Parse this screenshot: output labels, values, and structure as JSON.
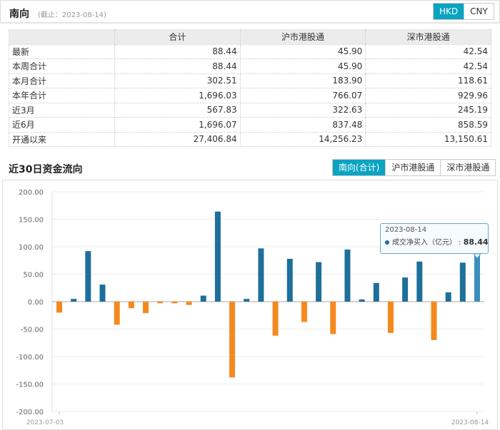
{
  "header": {
    "title": "南向",
    "subtitle": "(截止：2023-08-14)",
    "currency_options": [
      "HKD",
      "CNY"
    ],
    "currency_selected": "HKD"
  },
  "table": {
    "columns": [
      "",
      "合计",
      "沪市港股通",
      "深市港股通"
    ],
    "rows": [
      [
        "最新",
        "88.44",
        "45.90",
        "42.54"
      ],
      [
        "本周合计",
        "88.44",
        "45.90",
        "42.54"
      ],
      [
        "本月合计",
        "302.51",
        "183.90",
        "118.61"
      ],
      [
        "本年合计",
        "1,696.03",
        "766.07",
        "929.96"
      ],
      [
        "近3月",
        "567.83",
        "322.63",
        "245.19"
      ],
      [
        "近6月",
        "1,696.07",
        "837.48",
        "858.59"
      ],
      [
        "开通以来",
        "27,406.84",
        "14,256.23",
        "13,150.61"
      ]
    ]
  },
  "section": {
    "title": "近30日资金流向",
    "tabs": [
      "南向(合计)",
      "沪市港股通",
      "深市港股通"
    ],
    "tab_selected": "南向(合计)"
  },
  "chart_data": {
    "type": "bar",
    "series_name": "成交净买入（亿元）",
    "ylim": [
      -200,
      200
    ],
    "yticks": [
      "200.00",
      "150.00",
      "100.00",
      "50.00",
      "0.00",
      "-50.00",
      "-100.00",
      "-150.00",
      "-200.00"
    ],
    "x_first_label": "2023-07-03",
    "x_last_label": "2023-08-14",
    "values": [
      -20,
      5,
      92,
      31,
      -42,
      -12,
      -21,
      -3,
      -3,
      -6,
      11,
      164,
      -138,
      5,
      97,
      -62,
      78,
      -37,
      72,
      -59,
      95,
      4,
      34,
      -57,
      44,
      73,
      -70,
      17,
      71,
      88.44
    ],
    "colors": {
      "positive": "#1e6f9a",
      "negative": "#f5891f",
      "highlight": "#3a8fbf"
    },
    "tooltip": {
      "date": "2023-08-14",
      "label": "成交净买入（亿元）",
      "value": "88.44"
    }
  }
}
